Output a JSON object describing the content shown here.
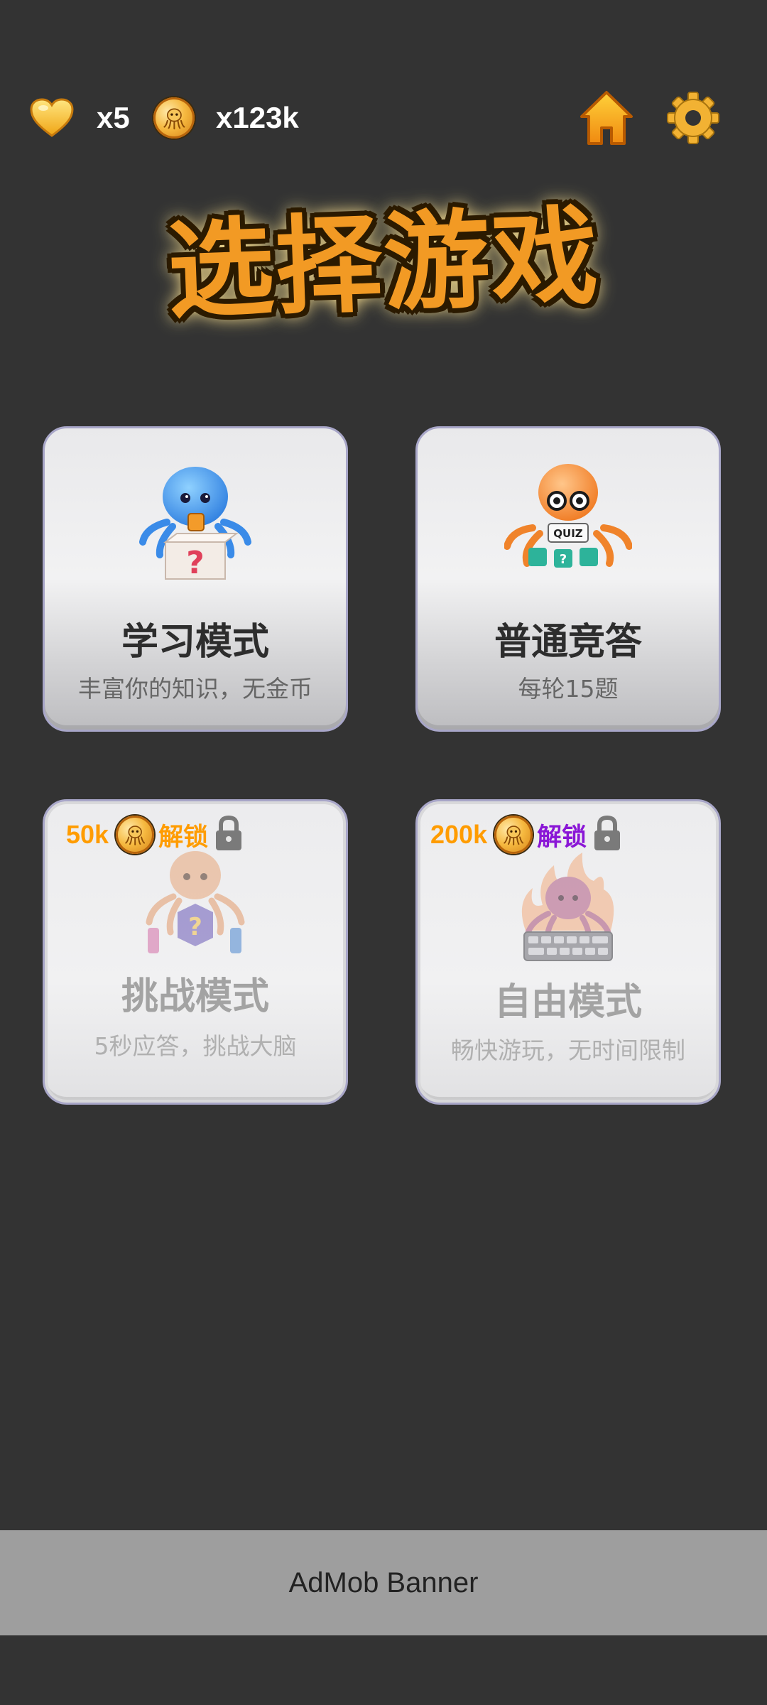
{
  "colors": {
    "background": "#333333",
    "accent_orange": "#ff9c00",
    "unlock_purple": "#8a16d6",
    "gold": "#f2b233"
  },
  "topbar": {
    "lives_icon": "heart-icon",
    "lives": "x5",
    "coins_icon": "octopus-coin-icon",
    "coins": "x123k",
    "home_icon": "home-icon",
    "settings_icon": "gear-icon"
  },
  "title": "选择游戏",
  "modes": [
    {
      "title": "学习模式",
      "subtitle": "丰富你的知识，无金币",
      "locked": false,
      "art": "blue-octopus-question-box"
    },
    {
      "title": "普通竞答",
      "subtitle": "每轮15题",
      "locked": false,
      "art": "orange-octopus-quiz"
    },
    {
      "title": "挑战模式",
      "subtitle": "5秒应答，挑战大脑",
      "locked": true,
      "price": "50k",
      "unlock": "解锁",
      "unlock_color": "#ff9c00",
      "art": "octopus-question-chips"
    },
    {
      "title": "自由模式",
      "subtitle": "畅快游玩，无时间限制",
      "locked": true,
      "price": "200k",
      "unlock": "解锁",
      "unlock_color": "#8a16d6",
      "art": "fire-octopus-keyboard"
    }
  ],
  "ad": {
    "label": "AdMob Banner"
  }
}
